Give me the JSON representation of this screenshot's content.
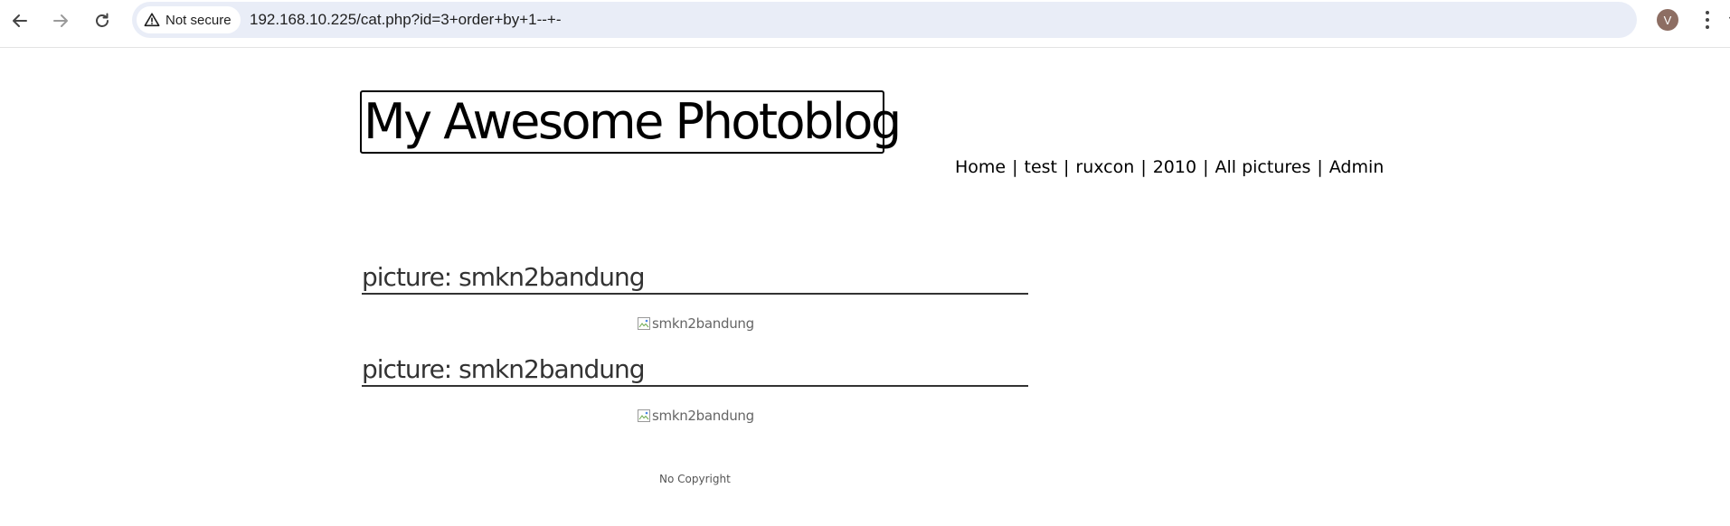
{
  "browser": {
    "security_label": "Not secure",
    "url": "192.168.10.225/cat.php?id=3+order+by+1--+-",
    "profile_initial": "V",
    "icons": {
      "back": "arrow-left-icon",
      "forward": "arrow-right-icon",
      "reload": "reload-icon",
      "warning": "warning-triangle-icon",
      "bookmark": "star-icon",
      "menu": "kebab-menu-icon"
    },
    "colors": {
      "omnibox": "#e9edf7",
      "avatar": "#8d6e63"
    }
  },
  "site": {
    "title": "My Awesome Photoblog",
    "menu": [
      "Home",
      "test",
      "ruxcon",
      "2010",
      "All pictures",
      "Admin"
    ],
    "menu_separator": "|"
  },
  "posts": [
    {
      "title": "picture: smkn2bandung",
      "image_alt": "smkn2bandung"
    },
    {
      "title": "picture: smkn2bandung",
      "image_alt": "smkn2bandung"
    }
  ],
  "footer": {
    "text": "No Copyright"
  }
}
